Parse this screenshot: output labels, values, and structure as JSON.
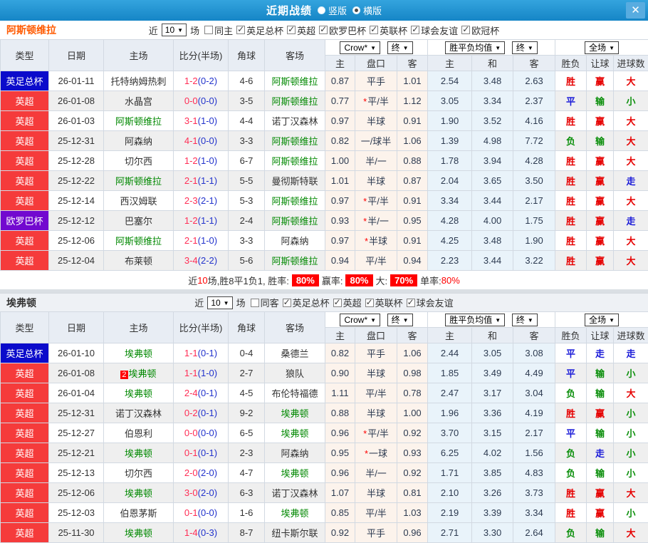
{
  "titlebar": {
    "title": "近期战绩",
    "vertical_label": "竖版",
    "horizontal_label": "横版",
    "selected_layout": "横版",
    "close_label": "✕"
  },
  "filter_common": {
    "near": "近",
    "count": "10",
    "games": "场"
  },
  "table_common": {
    "main_headers": [
      "类型",
      "日期",
      "主场",
      "比分(半场)",
      "角球",
      "客场"
    ],
    "sub_headers": [
      "主",
      "盘口",
      "客",
      "主",
      "和",
      "客",
      "胜负",
      "让球",
      "进球数"
    ],
    "dropdown_crow": "Crow*",
    "dropdown_final": "终",
    "dropdown_wdl_avg": "胜平负均值",
    "dropdown_final2": "终",
    "dropdown_fulltime": "全场"
  },
  "colors": {
    "leagues": {
      "英超": "#f53b3b",
      "英足总杯": "#0b0bcb",
      "欧罗巴杯": "#7209cf"
    },
    "results": {
      "胜": "#e60000",
      "平": "#1a1ad8",
      "负": "#0b8f0b",
      "赢": "#e60000",
      "输": "#0b8f0b",
      "走": "#1a1ad8",
      "大": "#e60000",
      "小": "#0b8f0b"
    },
    "focus_team": "#008800",
    "score_main": "#ff2d55",
    "score_half": "#2233cc"
  },
  "sections": [
    {
      "team": "阿斯顿维拉",
      "team_color": "#ff5a00",
      "same_label": "同主",
      "cups": [
        "英足总杯",
        "英超",
        "欧罗巴杯",
        "英联杯",
        "球会友谊",
        "欧冠杯"
      ],
      "rows": [
        {
          "league": "英足总杯",
          "date": "26-01-11",
          "home": "托特纳姆热刺",
          "hf": false,
          "score": "1-2",
          "half": "(0-2)",
          "corner": "4-6",
          "away": "阿斯顿维拉",
          "af": true,
          "w1": "0.87",
          "line": "平手",
          "star": false,
          "w2": "1.01",
          "e1": "2.54",
          "e2": "3.48",
          "e3": "2.63",
          "res": [
            "胜",
            "赢",
            "大"
          ]
        },
        {
          "league": "英超",
          "date": "26-01-08",
          "home": "水晶宫",
          "hf": false,
          "score": "0-0",
          "half": "(0-0)",
          "corner": "3-5",
          "away": "阿斯顿维拉",
          "af": true,
          "w1": "0.77",
          "line": "平/半",
          "star": true,
          "w2": "1.12",
          "e1": "3.05",
          "e2": "3.34",
          "e3": "2.37",
          "res": [
            "平",
            "输",
            "小"
          ]
        },
        {
          "league": "英超",
          "date": "26-01-03",
          "home": "阿斯顿维拉",
          "hf": true,
          "score": "3-1",
          "half": "(1-0)",
          "corner": "4-4",
          "away": "诺丁汉森林",
          "af": false,
          "w1": "0.97",
          "line": "半球",
          "star": false,
          "w2": "0.91",
          "e1": "1.90",
          "e2": "3.52",
          "e3": "4.16",
          "res": [
            "胜",
            "赢",
            "大"
          ]
        },
        {
          "league": "英超",
          "date": "25-12-31",
          "home": "阿森纳",
          "hf": false,
          "score": "4-1",
          "half": "(0-0)",
          "corner": "3-3",
          "away": "阿斯顿维拉",
          "af": true,
          "w1": "0.82",
          "line": "一/球半",
          "star": false,
          "w2": "1.06",
          "e1": "1.39",
          "e2": "4.98",
          "e3": "7.72",
          "res": [
            "负",
            "输",
            "大"
          ]
        },
        {
          "league": "英超",
          "date": "25-12-28",
          "home": "切尔西",
          "hf": false,
          "score": "1-2",
          "half": "(1-0)",
          "corner": "6-7",
          "away": "阿斯顿维拉",
          "af": true,
          "w1": "1.00",
          "line": "半/一",
          "star": false,
          "w2": "0.88",
          "e1": "1.78",
          "e2": "3.94",
          "e3": "4.28",
          "res": [
            "胜",
            "赢",
            "大"
          ]
        },
        {
          "league": "英超",
          "date": "25-12-22",
          "home": "阿斯顿维拉",
          "hf": true,
          "score": "2-1",
          "half": "(1-1)",
          "corner": "5-5",
          "away": "曼彻斯特联",
          "af": false,
          "w1": "1.01",
          "line": "半球",
          "star": false,
          "w2": "0.87",
          "e1": "2.04",
          "e2": "3.65",
          "e3": "3.50",
          "res": [
            "胜",
            "赢",
            "走"
          ]
        },
        {
          "league": "英超",
          "date": "25-12-14",
          "home": "西汉姆联",
          "hf": false,
          "score": "2-3",
          "half": "(2-1)",
          "corner": "5-3",
          "away": "阿斯顿维拉",
          "af": true,
          "w1": "0.97",
          "line": "平/半",
          "star": true,
          "w2": "0.91",
          "e1": "3.34",
          "e2": "3.44",
          "e3": "2.17",
          "res": [
            "胜",
            "赢",
            "大"
          ]
        },
        {
          "league": "欧罗巴杯",
          "date": "25-12-12",
          "home": "巴塞尔",
          "hf": false,
          "score": "1-2",
          "half": "(1-1)",
          "corner": "2-4",
          "away": "阿斯顿维拉",
          "af": true,
          "w1": "0.93",
          "line": "半/一",
          "star": true,
          "w2": "0.95",
          "e1": "4.28",
          "e2": "4.00",
          "e3": "1.75",
          "res": [
            "胜",
            "赢",
            "走"
          ]
        },
        {
          "league": "英超",
          "date": "25-12-06",
          "home": "阿斯顿维拉",
          "hf": true,
          "score": "2-1",
          "half": "(1-0)",
          "corner": "3-3",
          "away": "阿森纳",
          "af": false,
          "w1": "0.97",
          "line": "半球",
          "star": true,
          "w2": "0.91",
          "e1": "4.25",
          "e2": "3.48",
          "e3": "1.90",
          "res": [
            "胜",
            "赢",
            "大"
          ]
        },
        {
          "league": "英超",
          "date": "25-12-04",
          "home": "布莱顿",
          "hf": false,
          "score": "3-4",
          "half": "(2-2)",
          "corner": "5-6",
          "away": "阿斯顿维拉",
          "af": true,
          "w1": "0.94",
          "line": "平/半",
          "star": false,
          "w2": "0.94",
          "e1": "2.23",
          "e2": "3.44",
          "e3": "3.22",
          "res": [
            "胜",
            "赢",
            "大"
          ]
        }
      ],
      "summary": {
        "near": "近",
        "count": "10",
        "record": "场,胜8平1负1, 胜率:",
        "rate1": "80%",
        "label2": "赢率:",
        "rate2": "80%",
        "label3": "大:",
        "rate3": "70%",
        "label4": "单率:",
        "rate4": "80%"
      }
    },
    {
      "team": "埃弗顿",
      "team_color": "#333333",
      "same_label": "同客",
      "cups": [
        "英足总杯",
        "英超",
        "英联杯",
        "球会友谊"
      ],
      "rows": [
        {
          "league": "英足总杯",
          "date": "26-01-10",
          "home": "埃弗顿",
          "hf": true,
          "score": "1-1",
          "half": "(0-1)",
          "corner": "0-4",
          "away": "桑德兰",
          "af": false,
          "w1": "0.82",
          "line": "平手",
          "star": false,
          "w2": "1.06",
          "e1": "2.44",
          "e2": "3.05",
          "e3": "3.08",
          "res": [
            "平",
            "走",
            "走"
          ]
        },
        {
          "league": "英超",
          "date": "26-01-08",
          "home": "埃弗顿",
          "hf": true,
          "home_badge": "2",
          "score": "1-1",
          "half": "(1-0)",
          "corner": "2-7",
          "away": "狼队",
          "af": false,
          "w1": "0.90",
          "line": "半球",
          "star": false,
          "w2": "0.98",
          "e1": "1.85",
          "e2": "3.49",
          "e3": "4.49",
          "res": [
            "平",
            "输",
            "小"
          ]
        },
        {
          "league": "英超",
          "date": "26-01-04",
          "home": "埃弗顿",
          "hf": true,
          "score": "2-4",
          "half": "(0-1)",
          "corner": "4-5",
          "away": "布伦特福德",
          "af": false,
          "w1": "1.11",
          "line": "平/半",
          "star": false,
          "w2": "0.78",
          "e1": "2.47",
          "e2": "3.17",
          "e3": "3.04",
          "res": [
            "负",
            "输",
            "大"
          ]
        },
        {
          "league": "英超",
          "date": "25-12-31",
          "home": "诺丁汉森林",
          "hf": false,
          "score": "0-2",
          "half": "(0-1)",
          "corner": "9-2",
          "away": "埃弗顿",
          "af": true,
          "w1": "0.88",
          "line": "半球",
          "star": false,
          "w2": "1.00",
          "e1": "1.96",
          "e2": "3.36",
          "e3": "4.19",
          "res": [
            "胜",
            "赢",
            "小"
          ]
        },
        {
          "league": "英超",
          "date": "25-12-27",
          "home": "伯恩利",
          "hf": false,
          "score": "0-0",
          "half": "(0-0)",
          "corner": "6-5",
          "away": "埃弗顿",
          "af": true,
          "w1": "0.96",
          "line": "平/半",
          "star": true,
          "w2": "0.92",
          "e1": "3.70",
          "e2": "3.15",
          "e3": "2.17",
          "res": [
            "平",
            "输",
            "小"
          ]
        },
        {
          "league": "英超",
          "date": "25-12-21",
          "home": "埃弗顿",
          "hf": true,
          "score": "0-1",
          "half": "(0-1)",
          "corner": "2-3",
          "away": "阿森纳",
          "af": false,
          "w1": "0.95",
          "line": "一球",
          "star": true,
          "w2": "0.93",
          "e1": "6.25",
          "e2": "4.02",
          "e3": "1.56",
          "res": [
            "负",
            "走",
            "小"
          ]
        },
        {
          "league": "英超",
          "date": "25-12-13",
          "home": "切尔西",
          "hf": false,
          "score": "2-0",
          "half": "(2-0)",
          "corner": "4-7",
          "away": "埃弗顿",
          "af": true,
          "w1": "0.96",
          "line": "半/一",
          "star": false,
          "w2": "0.92",
          "e1": "1.71",
          "e2": "3.85",
          "e3": "4.83",
          "res": [
            "负",
            "输",
            "小"
          ]
        },
        {
          "league": "英超",
          "date": "25-12-06",
          "home": "埃弗顿",
          "hf": true,
          "score": "3-0",
          "half": "(2-0)",
          "corner": "6-3",
          "away": "诺丁汉森林",
          "af": false,
          "w1": "1.07",
          "line": "半球",
          "star": false,
          "w2": "0.81",
          "e1": "2.10",
          "e2": "3.26",
          "e3": "3.73",
          "res": [
            "胜",
            "赢",
            "大"
          ]
        },
        {
          "league": "英超",
          "date": "25-12-03",
          "home": "伯恩茅斯",
          "hf": false,
          "score": "0-1",
          "half": "(0-0)",
          "corner": "1-6",
          "away": "埃弗顿",
          "af": true,
          "w1": "0.85",
          "line": "平/半",
          "star": false,
          "w2": "1.03",
          "e1": "2.19",
          "e2": "3.39",
          "e3": "3.34",
          "res": [
            "胜",
            "赢",
            "小"
          ]
        },
        {
          "league": "英超",
          "date": "25-11-30",
          "home": "埃弗顿",
          "hf": true,
          "score": "1-4",
          "half": "(0-3)",
          "corner": "8-7",
          "away": "纽卡斯尔联",
          "af": false,
          "w1": "0.92",
          "line": "平手",
          "star": false,
          "w2": "0.96",
          "e1": "2.71",
          "e2": "3.30",
          "e3": "2.64",
          "res": [
            "负",
            "输",
            "大"
          ]
        }
      ]
    }
  ]
}
